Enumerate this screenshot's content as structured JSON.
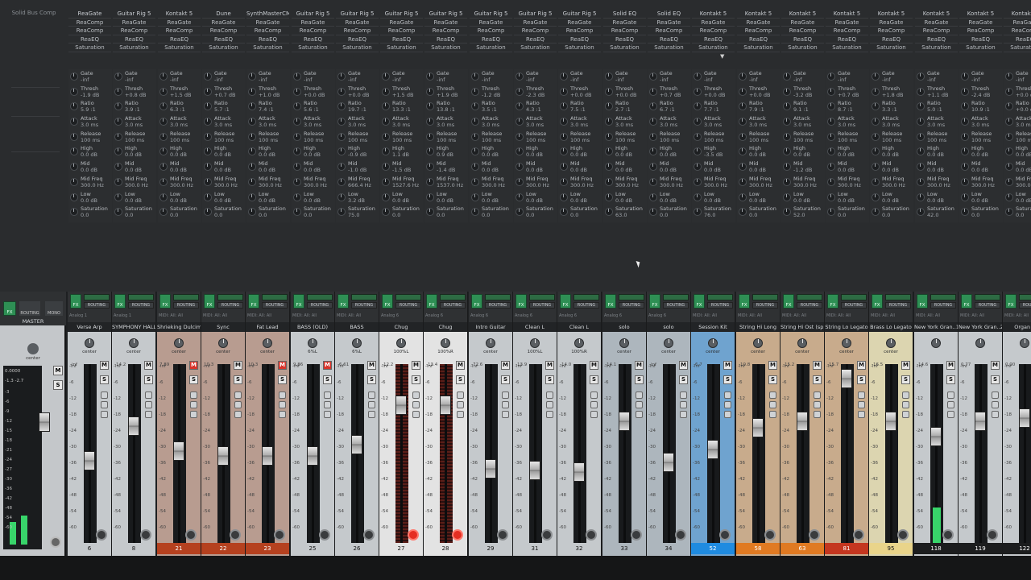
{
  "master": {
    "fx_label": "Solid Bus Comp",
    "fx_button": "FX",
    "routing": "ROUTING",
    "mono": "MONO",
    "name": "MASTER",
    "pan": "center",
    "readout_top": "0.0000",
    "readout_l": "-1.3",
    "readout_r": "-2.7",
    "mute": "M",
    "solo": "S",
    "scale": [
      "-3",
      "-6",
      "-9",
      "-12",
      "-15",
      "-18",
      "-21",
      "-24",
      "-27",
      "-30",
      "-36",
      "-42",
      "-48",
      "-54",
      "-60"
    ]
  },
  "fx_labels": {
    "fx": "FX",
    "routing": "ROUTING",
    "mute": "M",
    "solo": "S"
  },
  "param_names": [
    "Gate",
    "Thresh",
    "Ratio",
    "Attack",
    "Release",
    "High",
    "Mid",
    "Mid Freq",
    "Low",
    "Saturation"
  ],
  "scale_marks": [
    "-inf",
    "-6",
    "-12",
    "-18",
    "-24",
    "-30",
    "-36",
    "-42",
    "-48",
    "-54",
    "-60"
  ],
  "strips": [
    {
      "name": "Verse Arp",
      "num": "6",
      "fx": [
        "ReaGate",
        "ReaComp",
        "ReaComp",
        "ReaEQ",
        "Saturation"
      ],
      "input": "Analog 1",
      "pan": "center",
      "vol": "-inf",
      "color": "#c5c9cc",
      "numbar": "#c5c9cc",
      "fader": 0.55,
      "meter": 0,
      "armed": false,
      "mute_active": false,
      "params": [
        "-inf",
        "-1.9 dB",
        "5.9 :1",
        "3.0 ms",
        "100 ms",
        "0.0 dB",
        "0.0 dB",
        "300.0 Hz",
        "0.0 dB",
        "0.0"
      ]
    },
    {
      "name": "SYMPHONY HALL",
      "num": "8",
      "fx": [
        "Guitar Rig 5",
        "ReaGate",
        "ReaComp",
        "ReaEQ",
        "Saturation"
      ],
      "input": "Analog 1",
      "pan": "center",
      "vol": "-14.2",
      "color": "#c5c9cc",
      "numbar": "#c5c9cc",
      "fader": 0.33,
      "meter": 0,
      "armed": false,
      "mute_active": false,
      "params": [
        "-inf",
        "+0.8 dB",
        "3.9 :1",
        "3.0 ms",
        "100 ms",
        "0.0 dB",
        "0.0 dB",
        "300.0 Hz",
        "0.0 dB",
        "0.0"
      ]
    },
    {
      "name": "Shrieking Dulcimer",
      "num": "21",
      "fx": [
        "Kontakt 5",
        "ReaGate",
        "ReaComp",
        "ReaEQ",
        "Saturation"
      ],
      "input": "MIDI: All: All",
      "pan": "center",
      "vol": "7.89",
      "color": "#b89c90",
      "numbar": "#b5411f",
      "fader": 0.49,
      "meter": 0,
      "armed": false,
      "mute_active": true,
      "params": [
        "-inf",
        "+1.5 dB",
        "6.3 :1",
        "3.0 ms",
        "100 ms",
        "0.0 dB",
        "0.0 dB",
        "300.0 Hz",
        "0.0 dB",
        "0.0"
      ]
    },
    {
      "name": "Sync",
      "num": "22",
      "fx": [
        "Dune",
        "ReaGate",
        "ReaComp",
        "ReaEQ",
        "Saturation"
      ],
      "input": "MIDI: All: All",
      "pan": "center",
      "vol": "10.3",
      "color": "#b89c90",
      "numbar": "#b5411f",
      "fader": 0.52,
      "meter": 0,
      "armed": false,
      "mute_active": false,
      "params": [
        "-inf",
        "+0.7 dB",
        "5.7 :1",
        "3.0 ms",
        "100 ms",
        "0.0 dB",
        "0.0 dB",
        "300.0 Hz",
        "0.0 dB",
        "0.0"
      ]
    },
    {
      "name": "Fat Lead",
      "num": "23",
      "fx": [
        "SynthMasterCM",
        "ReaGate",
        "ReaComp",
        "ReaEQ",
        "Saturation"
      ],
      "input": "MIDI: All: All",
      "pan": "center",
      "vol": "10.3",
      "color": "#b89c90",
      "numbar": "#b5411f",
      "fader": 0.52,
      "meter": 0,
      "armed": false,
      "mute_active": true,
      "params": [
        "-inf",
        "+1.0 dB",
        "7.4 :1",
        "3.0 ms",
        "100 ms",
        "0.0 dB",
        "0.0 dB",
        "300.0 Hz",
        "0.0 dB",
        "0.0"
      ]
    },
    {
      "name": "BASS (OLD)",
      "num": "25",
      "fx": [
        "Guitar Rig 5",
        "ReaGate",
        "ReaComp",
        "ReaEQ",
        "Saturation"
      ],
      "input": "MIDI: All: All",
      "pan": "6%L",
      "vol": "9.86",
      "color": "#c5c9cc",
      "numbar": "#c5c9cc",
      "fader": 0.52,
      "meter": 0,
      "armed": false,
      "mute_active": true,
      "params": [
        "-inf",
        "+0.0 dB",
        "5.6 :1",
        "3.0 ms",
        "100 ms",
        "0.0 dB",
        "0.0 dB",
        "300.0 Hz",
        "0.0 dB",
        "0.0"
      ]
    },
    {
      "name": "BASS",
      "num": "26",
      "fx": [
        "Guitar Rig 5",
        "ReaGate",
        "ReaComp",
        "ReaEQ",
        "Saturation"
      ],
      "input": "MIDI: All: All",
      "pan": "6%L",
      "vol": "-6.61",
      "color": "#c5c9cc",
      "numbar": "#c5c9cc",
      "fader": 0.45,
      "meter": 0,
      "armed": false,
      "mute_active": false,
      "params": [
        "-inf",
        "+0.0 dB",
        "19.7 :1",
        "3.0 ms",
        "100 ms",
        "-0.9 dB",
        "-1.0 dB",
        "666.4 Hz",
        "3.2 dB",
        "75.0"
      ]
    },
    {
      "name": "Chug",
      "num": "27",
      "fx": [
        "Guitar Rig 5",
        "ReaGate",
        "ReaComp",
        "ReaEQ",
        "Saturation"
      ],
      "input": "Analog 6",
      "pan": "100%L",
      "vol": "-12.2",
      "color": "#e3e3e3",
      "numbar": "#e3e3e3",
      "fader": 0.2,
      "meter": 0,
      "armed": true,
      "mute_active": false,
      "params": [
        "-inf",
        "+1.5 dB",
        "13.3 :1",
        "3.0 ms",
        "100 ms",
        "1.1 dB",
        "-1.5 dB",
        "1527.6 Hz",
        "0.0 dB",
        "0.0"
      ]
    },
    {
      "name": "Chug",
      "num": "28",
      "fx": [
        "Guitar Rig 5",
        "ReaGate",
        "ReaComp",
        "ReaEQ",
        "Saturation"
      ],
      "input": "Analog 6",
      "pan": "100%R",
      "vol": "-13.4",
      "color": "#e3e3e3",
      "numbar": "#e3e3e3",
      "fader": 0.2,
      "meter": 0,
      "armed": true,
      "mute_active": false,
      "params": [
        "-inf",
        "+1.9 dB",
        "13.8 :1",
        "3.0 ms",
        "100 ms",
        "0.9 dB",
        "-1.4 dB",
        "1537.0 Hz",
        "0.0 dB",
        "0.0"
      ]
    },
    {
      "name": "Intro Guitar",
      "num": "29",
      "fx": [
        "Guitar Rig 5",
        "ReaGate",
        "ReaComp",
        "ReaEQ",
        "Saturation"
      ],
      "input": "Analog 6",
      "pan": "center",
      "vol": "-72.6",
      "color": "#c5c9cc",
      "numbar": "#c5c9cc",
      "fader": 0.6,
      "meter": 0,
      "armed": false,
      "mute_active": false,
      "params": [
        "-inf",
        "-1.2 dB",
        "3.5 :1",
        "3.0 ms",
        "100 ms",
        "0.0 dB",
        "0.0 dB",
        "300.0 Hz",
        "0.0 dB",
        "0.0"
      ]
    },
    {
      "name": "Clean L",
      "num": "31",
      "fx": [
        "Guitar Rig 5",
        "ReaGate",
        "ReaComp",
        "ReaEQ",
        "Saturation"
      ],
      "input": "Analog 6",
      "pan": "100%L",
      "vol": "-13.9",
      "color": "#c5c9cc",
      "numbar": "#c5c9cc",
      "fader": 0.61,
      "meter": 0,
      "armed": false,
      "mute_active": false,
      "params": [
        "-inf",
        "-2.3 dB",
        "4.3 :1",
        "3.0 ms",
        "100 ms",
        "0.0 dB",
        "0.0 dB",
        "300.0 Hz",
        "0.0 dB",
        "0.0"
      ]
    },
    {
      "name": "Clean L",
      "num": "32",
      "fx": [
        "Guitar Rig 5",
        "ReaGate",
        "ReaComp",
        "ReaEQ",
        "Saturation"
      ],
      "input": "Analog 6",
      "pan": "100%R",
      "vol": "-14.0",
      "color": "#c5c9cc",
      "numbar": "#c5c9cc",
      "fader": 0.62,
      "meter": 0,
      "armed": false,
      "mute_active": false,
      "params": [
        "-inf",
        "+0.0 dB",
        "7.5 :1",
        "3.0 ms",
        "100 ms",
        "0.0 dB",
        "0.0 dB",
        "300.0 Hz",
        "0.0 dB",
        "0.0"
      ]
    },
    {
      "name": "solo",
      "num": "33",
      "fx": [
        "Solid EQ",
        "ReaGate",
        "ReaComp",
        "ReaEQ",
        "Saturation"
      ],
      "input": "Analog 6",
      "pan": "center",
      "vol": "-14.1",
      "color": "#adb6bd",
      "numbar": "#adb6bd",
      "fader": 0.3,
      "meter": 0,
      "armed": false,
      "mute_active": false,
      "params": [
        "-inf",
        "+0.0 dB",
        "2.7 :1",
        "3.0 ms",
        "100 ms",
        "0.0 dB",
        "0.0 dB",
        "300.0 Hz",
        "0.0 dB",
        "63.0"
      ]
    },
    {
      "name": "solo",
      "num": "34",
      "fx": [
        "Solid EQ",
        "ReaGate",
        "ReaComp",
        "ReaEQ",
        "Saturation"
      ],
      "input": "Analog 6",
      "pan": "center",
      "vol": "-inf",
      "color": "#adb6bd",
      "numbar": "#adb6bd",
      "fader": 0.56,
      "meter": 0,
      "armed": false,
      "mute_active": false,
      "params": [
        "-inf",
        "+0.7 dB",
        "6.7 :1",
        "3.0 ms",
        "100 ms",
        "0.0 dB",
        "0.0 dB",
        "300.0 Hz",
        "0.0 dB",
        "0.0"
      ]
    },
    {
      "name": "Session Kit",
      "num": "52",
      "fx": [
        "Kontakt 5",
        "ReaGate",
        "ReaComp",
        "ReaEQ",
        "Saturation"
      ],
      "input": "MIDI: All: All",
      "pan": "center",
      "vol": "-6.7",
      "color": "#6fa3cf",
      "numbar": "#1f8be0",
      "fader": 0.48,
      "meter": 0,
      "armed": false,
      "mute_active": false,
      "params": [
        "-inf",
        "+0.0 dB",
        "7.7 :1",
        "3.0 ms",
        "100 ms",
        "-3.5 dB",
        "0.0 dB",
        "300.0 Hz",
        "0.0 dB",
        "76.0"
      ]
    },
    {
      "name": "String Hi Long",
      "num": "58",
      "fx": [
        "Kontakt 5",
        "ReaGate",
        "ReaComp",
        "ReaEQ",
        "Saturation"
      ],
      "input": "MIDI: All: All",
      "pan": "center",
      "vol": "-10.8",
      "color": "#c8ab8c",
      "numbar": "#e07a22",
      "fader": 0.34,
      "meter": 0,
      "armed": false,
      "mute_active": false,
      "params": [
        "-inf",
        "+0.0 dB",
        "7.9 :1",
        "3.0 ms",
        "100 ms",
        "0.0 dB",
        "0.0 dB",
        "300.0 Hz",
        "0.0 dB",
        "0.0"
      ]
    },
    {
      "name": "String Hi Ost (spi)",
      "num": "63",
      "fx": [
        "Kontakt 5",
        "ReaGate",
        "ReaComp",
        "ReaEQ",
        "Saturation"
      ],
      "input": "MIDI: All: All",
      "pan": "center",
      "vol": "-15.2",
      "color": "#c8ab8c",
      "numbar": "#e07a22",
      "fader": 0.3,
      "meter": 0,
      "armed": false,
      "mute_active": false,
      "params": [
        "-inf",
        "-3.2 dB",
        "9.1 :1",
        "3.0 ms",
        "100 ms",
        "0.0 dB",
        "-1.2 dB",
        "300.0 Hz",
        "0.0 dB",
        "52.0"
      ]
    },
    {
      "name": "String Lo Legato",
      "num": "81",
      "fx": [
        "Kontakt 5",
        "ReaGate",
        "ReaComp",
        "ReaEQ",
        "Saturation"
      ],
      "input": "MIDI: All: All",
      "pan": "center",
      "vol": "-15.7",
      "color": "#c8ab8c",
      "numbar": "#c4361f",
      "fader": 0.03,
      "meter": 0,
      "armed": false,
      "mute_active": false,
      "params": [
        "-inf",
        "+0.7 dB",
        "8.7 :1",
        "3.0 ms",
        "100 ms",
        "0.0 dB",
        "0.0 dB",
        "300.0 Hz",
        "0.0 dB",
        "0.0"
      ]
    },
    {
      "name": "Brass Lo Legato",
      "num": "95",
      "fx": [
        "Kontakt 5",
        "ReaGate",
        "ReaComp",
        "ReaEQ",
        "Saturation"
      ],
      "input": "MIDI: All: All",
      "pan": "center",
      "vol": "-16.5",
      "color": "#dcd5b0",
      "numbar": "#e9d48a",
      "fader": 0.3,
      "meter": 0,
      "armed": false,
      "mute_active": false,
      "params": [
        "-inf",
        "+1.8 dB",
        "3.3 :1",
        "3.0 ms",
        "100 ms",
        "0.0 dB",
        "0.0 dB",
        "300.0 Hz",
        "0.0 dB",
        "0.0"
      ]
    },
    {
      "name": "New York Gran..1",
      "num": "118",
      "fx": [
        "Kontakt 5",
        "ReaGate",
        "ReaComp",
        "ReaEQ",
        "Saturation"
      ],
      "input": "MIDI: All: All",
      "pan": "",
      "vol": "-14.6",
      "color": "#c5c9cc",
      "numbar": "#1c1d1e",
      "fader": 0.4,
      "meter": 0.2,
      "armed": false,
      "mute_active": false,
      "params": [
        "-inf",
        "+1.1 dB",
        "5.0 :1",
        "3.0 ms",
        "100 ms",
        "0.0 dB",
        "0.0 dB",
        "300.0 Hz",
        "0.0 dB",
        "42.0"
      ]
    },
    {
      "name": "New York Gran..2",
      "num": "119",
      "fx": [
        "Kontakt 5",
        "ReaGate",
        "ReaComp",
        "ReaEQ",
        "Saturation"
      ],
      "input": "MIDI: All: All",
      "pan": "",
      "vol": "0.77",
      "color": "#c5c9cc",
      "numbar": "#1c1d1e",
      "fader": 0.3,
      "meter": 0,
      "armed": false,
      "mute_active": false,
      "params": [
        "-inf",
        "-2.4 dB",
        "10.9 :1",
        "3.0 ms",
        "100 ms",
        "0.0 dB",
        "0.0 dB",
        "300.0 Hz",
        "0.0 dB",
        "0.0"
      ]
    },
    {
      "name": "Organ L",
      "num": "122",
      "fx": [
        "Kontakt 5",
        "ReaGate",
        "ReaComp",
        "ReaEQ",
        "Saturation"
      ],
      "input": "MIDI: All: All",
      "pan": "",
      "vol": "0.00",
      "color": "#c5c9cc",
      "numbar": "#1c1d1e",
      "fader": 0.28,
      "meter": 0,
      "armed": false,
      "mute_active": false,
      "params": [
        "-inf",
        "+0.0 dB",
        "+0.0 dB",
        "3.0 ms",
        "100 ms",
        "0.0 dB",
        "0.0 dB",
        "300.0 Hz",
        "0.0 dB",
        "0.0"
      ]
    }
  ]
}
